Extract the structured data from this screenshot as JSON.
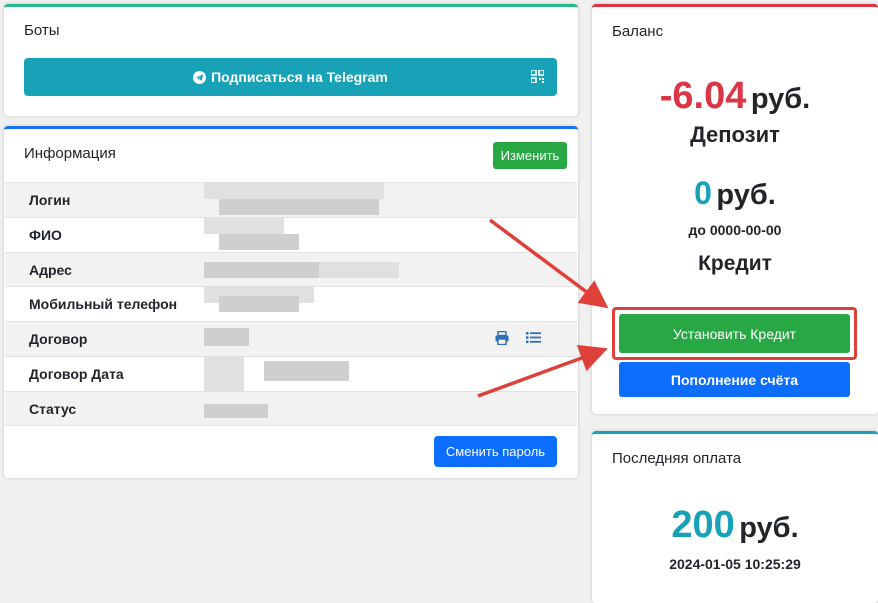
{
  "bots": {
    "title": "Боты",
    "telegram_button": "Подписаться на Telegram"
  },
  "info": {
    "title": "Информация",
    "edit_button": "Изменить",
    "rows": [
      {
        "label": "Логин"
      },
      {
        "label": "ФИО"
      },
      {
        "label": "Адрес"
      },
      {
        "label": "Мобильный телефон"
      },
      {
        "label": "Договор"
      },
      {
        "label": "Договор Дата"
      },
      {
        "label": "Статус"
      }
    ],
    "change_password_button": "Сменить пароль"
  },
  "balance": {
    "title": "Баланс",
    "deposit_value": "-6.04",
    "currency": "руб.",
    "deposit_label": "Депозит",
    "credit_value": "0",
    "credit_until": "до 0000-00-00",
    "credit_label": "Кредит",
    "set_credit_button": "Установить Кредит",
    "topup_button": "Пополнение счёта"
  },
  "last_payment": {
    "title": "Последняя оплата",
    "amount": "200",
    "currency": "руб.",
    "date": "2024-01-05 10:25:29"
  },
  "colors": {
    "success": "#28a745",
    "primary": "#0d6efd",
    "info": "#17a2b8",
    "danger": "#dc3545",
    "annotation": "#e0403a"
  }
}
